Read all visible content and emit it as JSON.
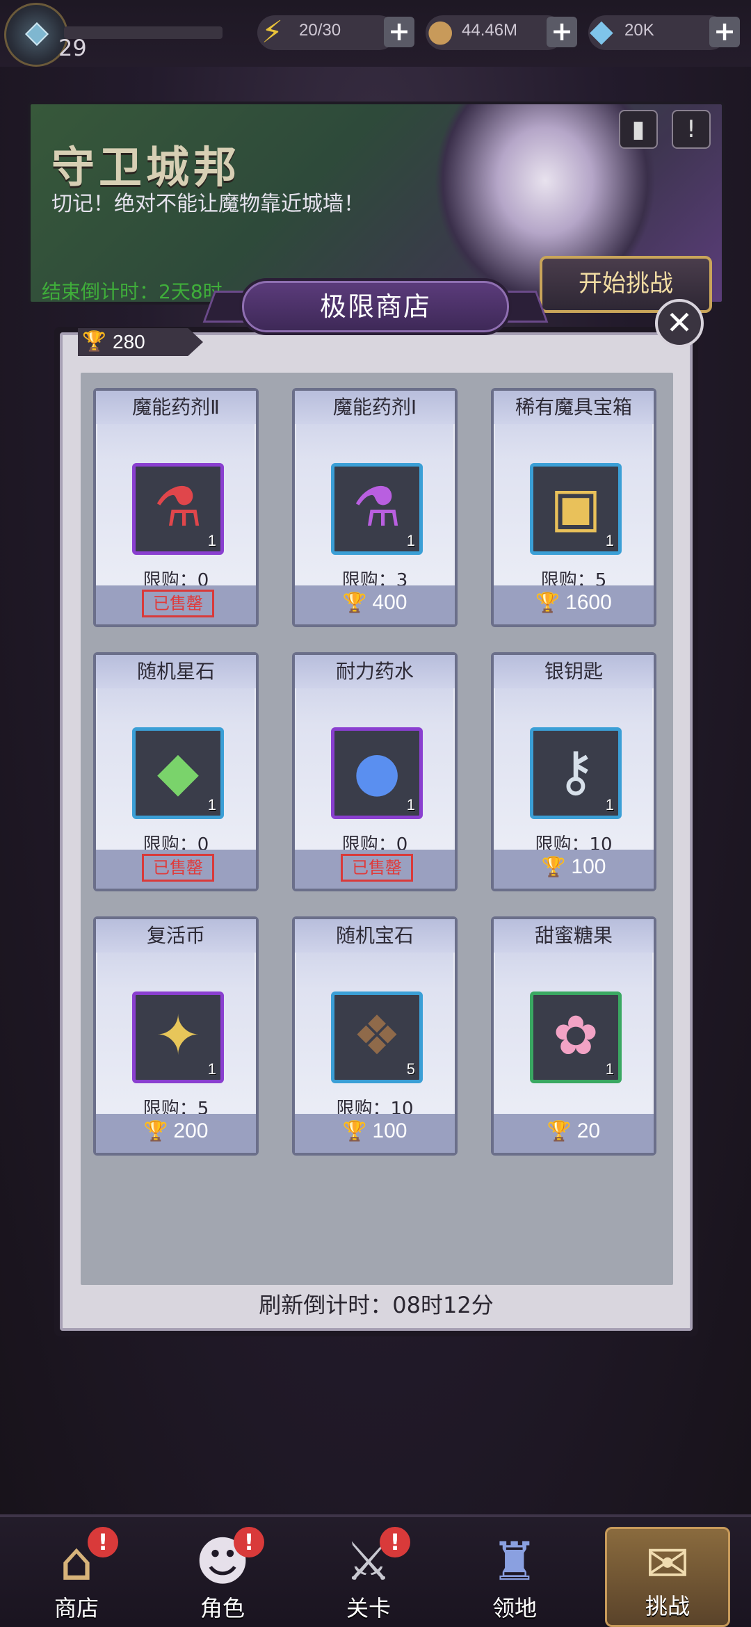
{
  "topbar": {
    "level": "29",
    "energy": "20/30",
    "gold": "44.46M",
    "diamonds": "20K",
    "plus": "+",
    "icons": {
      "energy": "lightning-icon",
      "gold": "coin-icon",
      "diamonds": "diamond-icon"
    }
  },
  "banner": {
    "title": "守卫城邦",
    "subtitle": "切记！绝对不能让魔物靠近城墙！",
    "countdown": "结束倒计时：2天8时",
    "start_label": "开始挑战"
  },
  "shop": {
    "title": "极限商店",
    "close": "✕",
    "currency_value": "280",
    "refresh_text": "刷新倒计时：08时12分",
    "limit_prefix": "限购：",
    "soldout_label": "已售罄",
    "items": [
      {
        "name": "魔能药剂Ⅱ",
        "glyph": "⚗",
        "glyph_color": "#e0464b",
        "frame": "purple",
        "qty": "1",
        "limit": "限购：0",
        "price": "",
        "sold_out": true
      },
      {
        "name": "魔能药剂Ⅰ",
        "glyph": "⚗",
        "glyph_color": "#b95fe0",
        "frame": "blue",
        "qty": "1",
        "limit": "限购：3",
        "price": "400",
        "sold_out": false
      },
      {
        "name": "稀有魔具宝箱",
        "glyph": "▣",
        "glyph_color": "#e9c15a",
        "frame": "blue",
        "qty": "1",
        "limit": "限购：5",
        "price": "1600",
        "sold_out": false
      },
      {
        "name": "随机星石",
        "glyph": "◆",
        "glyph_color": "#7ad36b",
        "frame": "blue",
        "qty": "1",
        "limit": "限购：0",
        "price": "",
        "sold_out": true
      },
      {
        "name": "耐力药水",
        "glyph": "●",
        "glyph_color": "#5a8ff0",
        "frame": "purple",
        "qty": "1",
        "limit": "限购：0",
        "price": "",
        "sold_out": true
      },
      {
        "name": "银钥匙",
        "glyph": "⚷",
        "glyph_color": "#d7e0ea",
        "frame": "blue",
        "qty": "1",
        "limit": "限购：10",
        "price": "100",
        "sold_out": false
      },
      {
        "name": "复活币",
        "glyph": "✦",
        "glyph_color": "#e7c65a",
        "frame": "purple",
        "qty": "1",
        "limit": "限购：5",
        "price": "200",
        "sold_out": false
      },
      {
        "name": "随机宝石",
        "glyph": "❖",
        "glyph_color": "#8f6a4a",
        "frame": "blue",
        "qty": "5",
        "limit": "限购：10",
        "price": "100",
        "sold_out": false
      },
      {
        "name": "甜蜜糖果",
        "glyph": "✿",
        "glyph_color": "#f2a3c5",
        "frame": "green",
        "qty": "1",
        "limit": "",
        "price": "20",
        "sold_out": false
      }
    ]
  },
  "nav": {
    "items": [
      {
        "label": "商店",
        "glyph": "⌂",
        "alert": "!"
      },
      {
        "label": "角色",
        "glyph": "☻",
        "alert": "!"
      },
      {
        "label": "关卡",
        "glyph": "⚔",
        "alert": "!"
      },
      {
        "label": "领地",
        "glyph": "♜",
        "alert": ""
      },
      {
        "label": "挑战",
        "glyph": "✉",
        "alert": ""
      }
    ]
  },
  "colors": {
    "soldout": "#e03a3a",
    "trophy": "#f3c84a",
    "frame_purple": "#8a3fd0",
    "frame_blue": "#3b9fd6",
    "frame_green": "#3aa862"
  }
}
